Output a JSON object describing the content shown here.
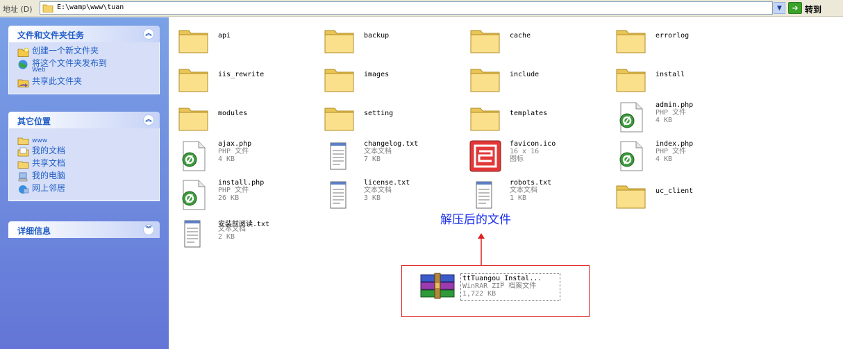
{
  "address_bar": {
    "label": "地址 (D)",
    "path": "E:\\wamp\\www\\tuan",
    "go_label": "转到"
  },
  "task_pane": {
    "panels": [
      {
        "title": "文件和文件夹任务",
        "items": [
          {
            "label": "创建一个新文件夹",
            "icon": "new-folder-icon"
          },
          {
            "label": "将这个文件夹发布到",
            "sub": "Web",
            "icon": "publish-web-icon"
          },
          {
            "label": "共享此文件夹",
            "icon": "share-folder-icon"
          }
        ]
      },
      {
        "title": "其它位置",
        "items": [
          {
            "label": "www",
            "icon": "folder-icon"
          },
          {
            "label": "我的文档",
            "icon": "my-documents-icon"
          },
          {
            "label": "共享文档",
            "icon": "shared-documents-icon"
          },
          {
            "label": "我的电脑",
            "icon": "my-computer-icon"
          },
          {
            "label": "网上邻居",
            "icon": "network-places-icon"
          }
        ]
      },
      {
        "title": "详细信息",
        "items": []
      }
    ]
  },
  "files": [
    {
      "name": "api",
      "type": "folder"
    },
    {
      "name": "backup",
      "type": "folder"
    },
    {
      "name": "cache",
      "type": "folder"
    },
    {
      "name": "errorlog",
      "type": "folder"
    },
    {
      "name": "iis_rewrite",
      "type": "folder"
    },
    {
      "name": "images",
      "type": "folder"
    },
    {
      "name": "include",
      "type": "folder"
    },
    {
      "name": "install",
      "type": "folder"
    },
    {
      "name": "modules",
      "type": "folder"
    },
    {
      "name": "setting",
      "type": "folder"
    },
    {
      "name": "templates",
      "type": "folder"
    },
    {
      "name": "admin.php",
      "type": "php",
      "kind": "PHP 文件",
      "size": "4 KB"
    },
    {
      "name": "ajax.php",
      "type": "php",
      "kind": "PHP 文件",
      "size": "4 KB"
    },
    {
      "name": "changelog.txt",
      "type": "txt",
      "kind": "文本文档",
      "size": "7 KB"
    },
    {
      "name": "favicon.ico",
      "type": "ico",
      "kind": "16 x 16",
      "size": "图标"
    },
    {
      "name": "index.php",
      "type": "php",
      "kind": "PHP 文件",
      "size": "4 KB"
    },
    {
      "name": "install.php",
      "type": "php",
      "kind": "PHP 文件",
      "size": "26 KB"
    },
    {
      "name": "license.txt",
      "type": "txt",
      "kind": "文本文档",
      "size": "3 KB"
    },
    {
      "name": "robots.txt",
      "type": "txt",
      "kind": "文本文档",
      "size": "1 KB"
    },
    {
      "name": "uc_client",
      "type": "folder"
    },
    {
      "name": "安装前阅读.txt",
      "type": "txt",
      "kind": "文本文档",
      "size": "2 KB"
    }
  ],
  "annotation": {
    "label": "解压后的文件",
    "archive": {
      "name": "ttTuangou_Instal...",
      "kind": "WinRAR ZIP 档案文件",
      "size": "1,722 KB"
    }
  }
}
